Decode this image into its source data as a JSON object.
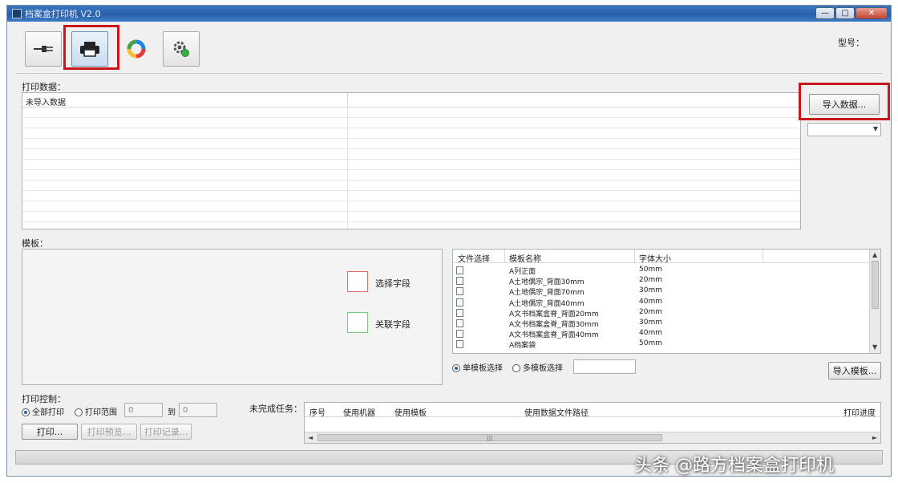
{
  "window": {
    "title": "档案盒打印机 V2.0",
    "minimize_glyph": "—",
    "maximize_glyph": "□",
    "close_glyph": "✕"
  },
  "toolbar": {
    "buttons": [
      {
        "name": "connect",
        "icon": "plug-icon"
      },
      {
        "name": "printer",
        "icon": "printer-icon",
        "selected": true
      },
      {
        "name": "color",
        "icon": "color-ring-icon"
      },
      {
        "name": "settings",
        "icon": "gear-icon"
      }
    ],
    "right_label": "型号："
  },
  "print_data": {
    "label": "打印数据：",
    "table_header": "未导入数据",
    "import_button": "导入数据...",
    "dropdown_value": ""
  },
  "template": {
    "label": "模板：",
    "legend_selected": "选择字段",
    "legend_linked": "关联字段",
    "columns": [
      "文件选择",
      "模板名称",
      "字体大小"
    ],
    "rows": [
      {
        "name": "A列正面",
        "size": "50mm"
      },
      {
        "name": "A土地偶宗_背面30mm",
        "size": "20mm"
      },
      {
        "name": "A土地偶宗_背面70mm",
        "size": "30mm"
      },
      {
        "name": "A土地偶宗_背面40mm",
        "size": "40mm"
      },
      {
        "name": "A文书档案盒脊_背面20mm",
        "size": "20mm"
      },
      {
        "name": "A文书档案盒脊_背面30mm",
        "size": "30mm"
      },
      {
        "name": "A文书档案盒脊_背面40mm",
        "size": "40mm"
      },
      {
        "name": "A档案袋",
        "size": "50mm"
      }
    ],
    "radio_single": "单模板选择",
    "radio_multi": "多模板选择",
    "import_template_button": "导入模板..."
  },
  "print_settings": {
    "label": "打印控制：",
    "radio_all": "全部打印",
    "radio_range": "打印范围",
    "range_from": "0",
    "range_to_label": "到",
    "range_to": "0",
    "print_button": "打印...",
    "preview_button": "打印预览...",
    "record_button": "打印记录..."
  },
  "queue": {
    "label": "未完成任务：",
    "columns": [
      "序号",
      "使用机器",
      "使用模板",
      "使用数据文件路径",
      "打印进度"
    ],
    "scroll_center": "|||"
  },
  "watermark": "头条 @路方档案盒打印机"
}
